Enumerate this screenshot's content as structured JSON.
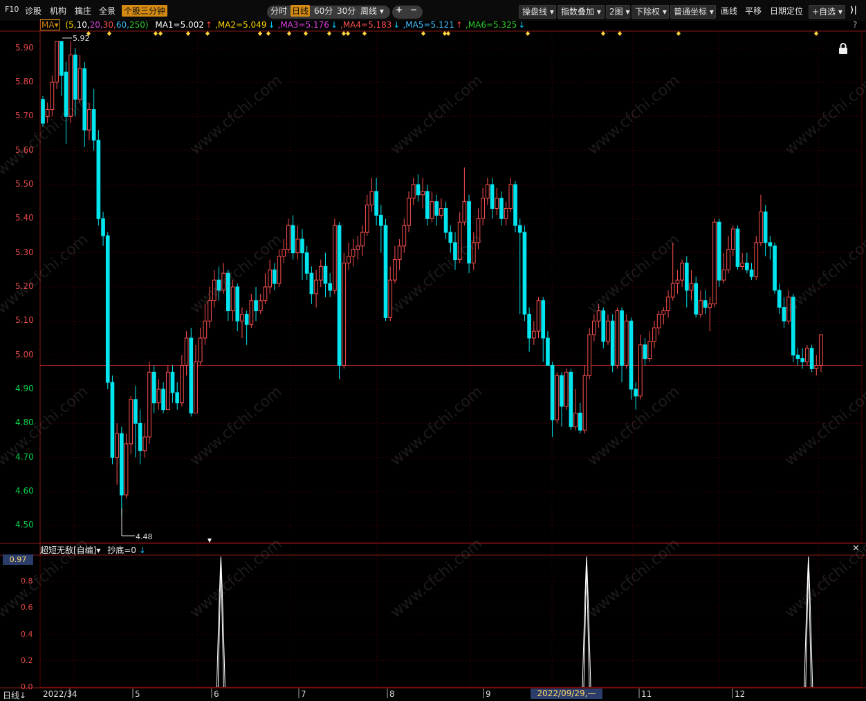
{
  "toolbar": {
    "left_items": [
      "F10",
      "诊股",
      "机构",
      "擒庄",
      "全景"
    ],
    "active_tab": "个股三分钟",
    "period_tabs": [
      "分时",
      "日线",
      "60分",
      "30分"
    ],
    "period_selected": "日线",
    "week_dropdown": "周线",
    "plus": "+",
    "minus": "−",
    "right_dropdowns": [
      "操盘线",
      "指数叠加",
      "2图",
      "下除权",
      "普通坐标"
    ],
    "right_items": [
      "画线",
      "平移",
      "日期定位"
    ],
    "favorites": "+自选",
    "collapse_icon": "⟩|"
  },
  "legend": {
    "ma_button": "MA",
    "params_prefix": "(5,",
    "params": [
      {
        "text": "10,",
        "color": "#ffffff"
      },
      {
        "text": "20,",
        "color": "#e040e0"
      },
      {
        "text": "30,",
        "color": "#ff5050"
      },
      {
        "text": "60,",
        "color": "#40c0ff"
      },
      {
        "text": "250)",
        "color": "#30d030"
      }
    ],
    "ma_values": [
      {
        "text": "MA1=5.002",
        "arrow": "↑",
        "color": "#ffffff",
        "arrow_color": "#ff4040"
      },
      {
        "text": ",MA2=5.049",
        "arrow": "↓",
        "color": "#ffd700",
        "arrow_color": "#00c8ff"
      },
      {
        "text": ",MA3=5.176",
        "arrow": "↓",
        "color": "#e040e0",
        "arrow_color": "#00c8ff"
      },
      {
        "text": ",MA4=5.183",
        "arrow": "↓",
        "color": "#ff5050",
        "arrow_color": "#00c8ff"
      },
      {
        "text": ",MA5=5.121",
        "arrow": "↑",
        "color": "#40c0ff",
        "arrow_color": "#ff4040"
      },
      {
        "text": ",MA6=5.325",
        "arrow": "↓",
        "color": "#30d030",
        "arrow_color": "#00c8ff"
      }
    ],
    "help": "?"
  },
  "price_axis": [
    "5.90",
    "5.80",
    "5.70",
    "5.60",
    "5.50",
    "5.40",
    "5.30",
    "5.20",
    "5.10",
    "5.00",
    "4.90",
    "4.80",
    "4.70",
    "4.60",
    "4.50"
  ],
  "max_label": "5.92",
  "min_label": "4.48",
  "lock_icon": "lock-icon",
  "indicator": {
    "name": "超短无敌[自编]",
    "signal": "抄底=0",
    "signal_arrow": "↓",
    "close": "✕",
    "current_value": "0.97",
    "axis": [
      "0.8",
      "0.6",
      "0.4",
      "0.2",
      "0.0"
    ]
  },
  "date_axis": {
    "mode": "日线",
    "mode_arrow": "↓",
    "labels": [
      "2022/3",
      "4",
      "5",
      "6",
      "7",
      "8",
      "9",
      "11",
      "12"
    ],
    "cursor_date": "2022/09/29,—"
  },
  "watermark": "www.cfchi.com",
  "colors": {
    "up": "#ff5050",
    "down": "#00e5ee",
    "accent": "#d48a12",
    "grid": "#5a0000",
    "axis_red": "#e34747",
    "axis_green": "#00d34a"
  },
  "chart_data": {
    "type": "candlestick",
    "ylim": [
      4.45,
      5.95
    ],
    "current_price_line": 4.97,
    "candles": [
      [
        5.75,
        5.68,
        5.76,
        5.67
      ],
      [
        5.7,
        5.72,
        5.74,
        5.68
      ],
      [
        5.72,
        5.8,
        5.82,
        5.7
      ],
      [
        5.8,
        5.92,
        5.92,
        5.78
      ],
      [
        5.92,
        5.82,
        5.92,
        5.76
      ],
      [
        5.83,
        5.7,
        5.86,
        5.62
      ],
      [
        5.7,
        5.88,
        5.92,
        5.68
      ],
      [
        5.88,
        5.75,
        5.9,
        5.7
      ],
      [
        5.75,
        5.84,
        5.88,
        5.74
      ],
      [
        5.84,
        5.66,
        5.86,
        5.61
      ],
      [
        5.66,
        5.72,
        5.74,
        5.63
      ],
      [
        5.72,
        5.63,
        5.78,
        5.6
      ],
      [
        5.63,
        5.4,
        5.66,
        5.38
      ],
      [
        5.4,
        5.35,
        5.42,
        5.32
      ],
      [
        5.35,
        4.92,
        5.36,
        4.9
      ],
      [
        4.92,
        4.7,
        4.94,
        4.68
      ],
      [
        4.7,
        4.77,
        4.8,
        4.62
      ],
      [
        4.77,
        4.59,
        4.79,
        4.53
      ],
      [
        4.59,
        4.74,
        4.77,
        4.58
      ],
      [
        4.74,
        4.87,
        4.88,
        4.71
      ],
      [
        4.87,
        4.8,
        4.91,
        4.7
      ],
      [
        4.8,
        4.72,
        4.84,
        4.68
      ],
      [
        4.72,
        4.76,
        4.8,
        4.7
      ],
      [
        4.76,
        4.95,
        4.98,
        4.74
      ],
      [
        4.95,
        4.86,
        4.97,
        4.83
      ],
      [
        4.86,
        4.9,
        4.93,
        4.84
      ],
      [
        4.9,
        4.84,
        4.92,
        4.83
      ],
      [
        4.84,
        4.95,
        4.97,
        4.84
      ],
      [
        4.95,
        4.89,
        4.97,
        4.86
      ],
      [
        4.89,
        4.86,
        4.92,
        4.84
      ],
      [
        4.86,
        4.97,
        5.0,
        4.85
      ],
      [
        4.97,
        5.05,
        5.07,
        4.94
      ],
      [
        5.05,
        4.83,
        5.08,
        4.82
      ],
      [
        4.83,
        4.98,
        5.03,
        4.83
      ],
      [
        4.98,
        5.05,
        5.08,
        4.97
      ],
      [
        5.05,
        5.1,
        5.15,
        5.03
      ],
      [
        5.1,
        5.16,
        5.2,
        5.08
      ],
      [
        5.16,
        5.22,
        5.25,
        5.14
      ],
      [
        5.22,
        5.19,
        5.26,
        5.16
      ],
      [
        5.19,
        5.24,
        5.27,
        5.18
      ],
      [
        5.24,
        5.13,
        5.25,
        5.1
      ],
      [
        5.13,
        5.2,
        5.22,
        5.1
      ],
      [
        5.2,
        5.1,
        5.21,
        5.07
      ],
      [
        5.1,
        5.12,
        5.14,
        5.05
      ],
      [
        5.12,
        5.09,
        5.13,
        5.03
      ],
      [
        5.09,
        5.16,
        5.18,
        5.08
      ],
      [
        5.16,
        5.13,
        5.2,
        5.1
      ],
      [
        5.13,
        5.16,
        5.18,
        5.12
      ],
      [
        5.16,
        5.2,
        5.24,
        5.15
      ],
      [
        5.2,
        5.25,
        5.28,
        5.18
      ],
      [
        5.25,
        5.21,
        5.27,
        5.19
      ],
      [
        5.21,
        5.29,
        5.31,
        5.2
      ],
      [
        5.29,
        5.31,
        5.34,
        5.27
      ],
      [
        5.31,
        5.38,
        5.4,
        5.3
      ],
      [
        5.38,
        5.3,
        5.41,
        5.28
      ],
      [
        5.3,
        5.34,
        5.38,
        5.28
      ],
      [
        5.34,
        5.3,
        5.37,
        5.22
      ],
      [
        5.3,
        5.24,
        5.32,
        5.22
      ],
      [
        5.24,
        5.18,
        5.26,
        5.15
      ],
      [
        5.18,
        5.22,
        5.25,
        5.14
      ],
      [
        5.22,
        5.26,
        5.28,
        5.2
      ],
      [
        5.26,
        5.21,
        5.3,
        5.17
      ],
      [
        5.21,
        5.19,
        5.24,
        5.17
      ],
      [
        5.19,
        5.38,
        5.4,
        5.18
      ],
      [
        5.38,
        4.97,
        5.39,
        4.93
      ],
      [
        4.97,
        5.27,
        5.3,
        4.96
      ],
      [
        5.27,
        5.29,
        5.33,
        5.25
      ],
      [
        5.29,
        5.31,
        5.34,
        5.26
      ],
      [
        5.31,
        5.32,
        5.35,
        5.28
      ],
      [
        5.32,
        5.36,
        5.38,
        5.29
      ],
      [
        5.36,
        5.44,
        5.47,
        5.35
      ],
      [
        5.44,
        5.48,
        5.52,
        5.42
      ],
      [
        5.48,
        5.41,
        5.52,
        5.38
      ],
      [
        5.41,
        5.38,
        5.44,
        5.3
      ],
      [
        5.38,
        5.11,
        5.4,
        5.1
      ],
      [
        5.11,
        5.22,
        5.26,
        5.1
      ],
      [
        5.22,
        5.28,
        5.32,
        5.21
      ],
      [
        5.28,
        5.32,
        5.34,
        5.25
      ],
      [
        5.32,
        5.38,
        5.4,
        5.3
      ],
      [
        5.38,
        5.46,
        5.48,
        5.36
      ],
      [
        5.46,
        5.5,
        5.52,
        5.44
      ],
      [
        5.5,
        5.47,
        5.53,
        5.45
      ],
      [
        5.47,
        5.48,
        5.52,
        5.43
      ],
      [
        5.48,
        5.4,
        5.5,
        5.38
      ],
      [
        5.4,
        5.45,
        5.48,
        5.39
      ],
      [
        5.45,
        5.41,
        5.47,
        5.38
      ],
      [
        5.41,
        5.43,
        5.46,
        5.4
      ],
      [
        5.43,
        5.36,
        5.45,
        5.34
      ],
      [
        5.36,
        5.33,
        5.38,
        5.3
      ],
      [
        5.33,
        5.28,
        5.36,
        5.25
      ],
      [
        5.28,
        5.39,
        5.42,
        5.27
      ],
      [
        5.39,
        5.45,
        5.55,
        5.38
      ],
      [
        5.45,
        5.27,
        5.47,
        5.24
      ],
      [
        5.27,
        5.33,
        5.36,
        5.25
      ],
      [
        5.33,
        5.4,
        5.43,
        5.31
      ],
      [
        5.4,
        5.46,
        5.49,
        5.38
      ],
      [
        5.46,
        5.5,
        5.52,
        5.44
      ],
      [
        5.5,
        5.43,
        5.52,
        5.4
      ],
      [
        5.43,
        5.46,
        5.49,
        5.41
      ],
      [
        5.46,
        5.4,
        5.48,
        5.38
      ],
      [
        5.4,
        5.43,
        5.45,
        5.38
      ],
      [
        5.43,
        5.5,
        5.52,
        5.42
      ],
      [
        5.5,
        5.38,
        5.51,
        5.36
      ],
      [
        5.38,
        5.36,
        5.4,
        5.12
      ],
      [
        5.36,
        5.12,
        5.38,
        5.1
      ],
      [
        5.12,
        5.05,
        5.14,
        5.01
      ],
      [
        5.05,
        5.07,
        5.1,
        5.03
      ],
      [
        5.07,
        5.16,
        5.17,
        5.05
      ],
      [
        5.16,
        5.05,
        5.17,
        4.98
      ],
      [
        5.05,
        4.97,
        5.07,
        4.97
      ],
      [
        4.97,
        4.81,
        4.98,
        4.76
      ],
      [
        4.81,
        4.94,
        4.95,
        4.8
      ],
      [
        4.94,
        4.85,
        4.95,
        4.79
      ],
      [
        4.85,
        4.95,
        4.96,
        4.84
      ],
      [
        4.95,
        4.79,
        4.96,
        4.78
      ],
      [
        4.79,
        4.83,
        4.9,
        4.78
      ],
      [
        4.83,
        4.78,
        4.86,
        4.77
      ],
      [
        4.78,
        4.94,
        4.97,
        4.77
      ],
      [
        4.94,
        5.06,
        5.08,
        4.93
      ],
      [
        5.06,
        5.1,
        5.12,
        5.04
      ],
      [
        5.1,
        5.13,
        5.15,
        5.08
      ],
      [
        5.13,
        5.04,
        5.14,
        5.02
      ],
      [
        5.04,
        5.1,
        5.12,
        5.03
      ],
      [
        5.1,
        4.97,
        5.12,
        4.95
      ],
      [
        4.97,
        5.13,
        5.14,
        4.96
      ],
      [
        5.13,
        4.97,
        5.14,
        4.92
      ],
      [
        4.97,
        5.1,
        5.12,
        4.96
      ],
      [
        5.1,
        4.9,
        5.11,
        4.87
      ],
      [
        4.9,
        4.88,
        4.92,
        4.84
      ],
      [
        4.88,
        5.03,
        5.06,
        4.87
      ],
      [
        5.03,
        4.99,
        5.05,
        4.97
      ],
      [
        4.99,
        5.04,
        5.07,
        4.98
      ],
      [
        5.04,
        5.08,
        5.1,
        5.02
      ],
      [
        5.08,
        5.12,
        5.13,
        5.06
      ],
      [
        5.12,
        5.13,
        5.14,
        5.09
      ],
      [
        5.13,
        5.17,
        5.19,
        5.11
      ],
      [
        5.17,
        5.21,
        5.33,
        5.16
      ],
      [
        5.21,
        5.22,
        5.25,
        5.18
      ],
      [
        5.22,
        5.27,
        5.28,
        5.2
      ],
      [
        5.27,
        5.19,
        5.29,
        5.14
      ],
      [
        5.19,
        5.21,
        5.25,
        5.16
      ],
      [
        5.21,
        5.12,
        5.23,
        5.11
      ],
      [
        5.12,
        5.16,
        5.19,
        5.11
      ],
      [
        5.16,
        5.14,
        5.19,
        5.12
      ],
      [
        5.14,
        5.15,
        5.17,
        5.07
      ],
      [
        5.15,
        5.39,
        5.4,
        5.14
      ],
      [
        5.39,
        5.22,
        5.4,
        5.2
      ],
      [
        5.22,
        5.25,
        5.3,
        5.21
      ],
      [
        5.25,
        5.31,
        5.35,
        5.24
      ],
      [
        5.31,
        5.37,
        5.38,
        5.29
      ],
      [
        5.37,
        5.26,
        5.38,
        5.25
      ],
      [
        5.26,
        5.27,
        5.3,
        5.25
      ],
      [
        5.27,
        5.25,
        5.3,
        5.24
      ],
      [
        5.25,
        5.23,
        5.27,
        5.22
      ],
      [
        5.23,
        5.33,
        5.35,
        5.22
      ],
      [
        5.33,
        5.42,
        5.47,
        5.32
      ],
      [
        5.42,
        5.33,
        5.44,
        5.29
      ],
      [
        5.33,
        5.32,
        5.35,
        5.28
      ],
      [
        5.32,
        5.19,
        5.33,
        5.18
      ],
      [
        5.19,
        5.14,
        5.21,
        5.12
      ],
      [
        5.14,
        5.1,
        5.17,
        5.08
      ],
      [
        5.1,
        5.17,
        5.19,
        5.09
      ],
      [
        5.17,
        5.0,
        5.18,
        4.98
      ],
      [
        5.0,
        4.99,
        5.02,
        4.97
      ],
      [
        4.99,
        4.98,
        5.02,
        4.96
      ],
      [
        4.98,
        5.02,
        5.03,
        4.97
      ],
      [
        5.02,
        4.96,
        5.03,
        4.95
      ],
      [
        4.96,
        4.97,
        5.0,
        4.94
      ],
      [
        4.97,
        5.06,
        5.06,
        4.95
      ]
    ]
  },
  "indicator_chart": {
    "ylim": [
      0,
      1
    ],
    "spikes": [
      0.22,
      0.665,
      0.935
    ]
  }
}
